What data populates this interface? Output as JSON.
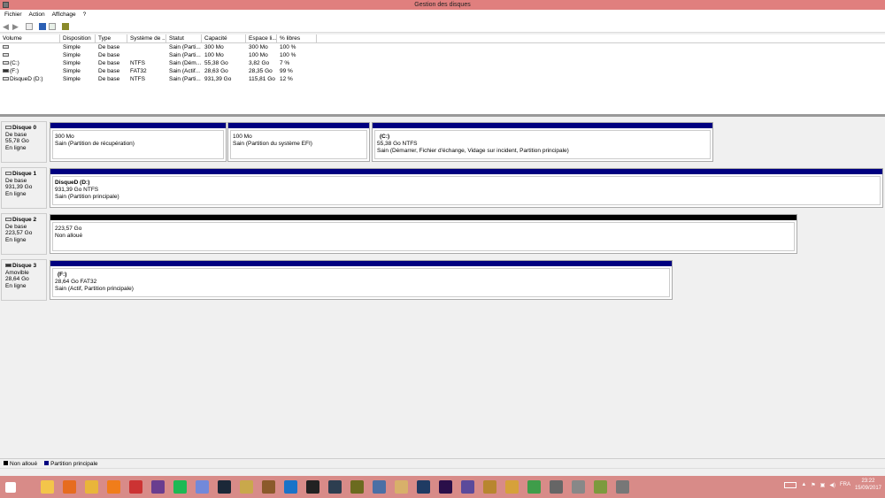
{
  "window": {
    "title": "Gestion des disques"
  },
  "menu": [
    "Fichier",
    "Action",
    "Affichage",
    "?"
  ],
  "toolbar": [
    "back-icon",
    "forward-icon",
    "console-tree-icon",
    "help-icon",
    "properties-icon",
    "disk-action-icon"
  ],
  "volume_list": {
    "columns": [
      "Volume",
      "Disposition",
      "Type",
      "Système de ...",
      "Statut",
      "Capacité",
      "Espace li...",
      "% libres"
    ],
    "rows": [
      [
        "",
        "Simple",
        "De base",
        "",
        "Sain (Parti...",
        "300 Mo",
        "300 Mo",
        "100 %"
      ],
      [
        "",
        "Simple",
        "De base",
        "",
        "Sain (Parti...",
        "100 Mo",
        "100 Mo",
        "100 %"
      ],
      [
        "(C:)",
        "Simple",
        "De base",
        "NTFS",
        "Sain (Dém...",
        "55,38 Go",
        "3,82 Go",
        "7 %"
      ],
      [
        "(F:)",
        "Simple",
        "De base",
        "FAT32",
        "Sain (Actif...",
        "28,63 Go",
        "28,35 Go",
        "99 %"
      ],
      [
        "DisqueD (D:)",
        "Simple",
        "De base",
        "NTFS",
        "Sain (Parti...",
        "931,39 Go",
        "115,81 Go",
        "12 %"
      ]
    ]
  },
  "disks": [
    {
      "name": "Disque 0",
      "type": "De base",
      "size": "55,78 Go",
      "status": "En ligne",
      "partitions": [
        {
          "title": "",
          "line1": "300 Mo",
          "line2": "Sain (Partition de récupération)"
        },
        {
          "title": "",
          "line1": "100 Mo",
          "line2": "Sain (Partition du système EFI)"
        },
        {
          "title": "(C:)",
          "line1": "55,38 Go NTFS",
          "line2": "Sain (Démarrer, Fichier d'échange, Vidage sur incident, Partition principale)"
        }
      ]
    },
    {
      "name": "Disque 1",
      "type": "De base",
      "size": "931,39 Go",
      "status": "En ligne",
      "partitions": [
        {
          "title": "DisqueD  (D:)",
          "line1": "931,39 Go NTFS",
          "line2": "Sain (Partition principale)"
        }
      ]
    },
    {
      "name": "Disque 2",
      "type": "De base",
      "size": "223,57 Go",
      "status": "En ligne",
      "partitions": [
        {
          "title": "",
          "line1": "223,57 Go",
          "line2": "Non alloué"
        }
      ]
    },
    {
      "name": "Disque 3",
      "type": "Amovible",
      "size": "28,64 Go",
      "status": "En ligne",
      "partitions": [
        {
          "title": "(F:)",
          "line1": "28,64 Go FAT32",
          "line2": "Sain (Actif, Partition principale)"
        }
      ]
    }
  ],
  "legend": [
    {
      "label": "Non alloué",
      "color": "#000000"
    },
    {
      "label": "Partition principale",
      "color": "#000080"
    }
  ],
  "taskbar": {
    "language": "FRA",
    "time": "23:22",
    "date": "15/09/2017"
  }
}
